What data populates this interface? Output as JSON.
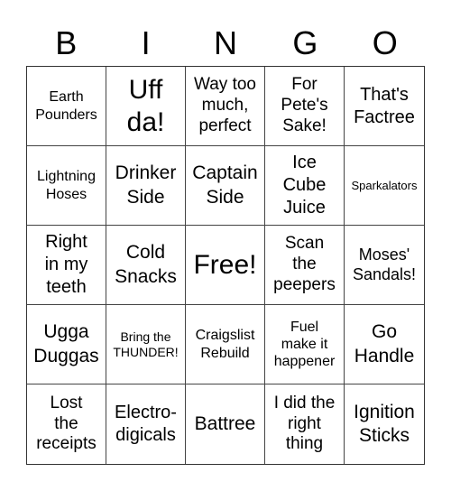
{
  "header": {
    "letters": [
      "B",
      "I",
      "N",
      "G",
      "O"
    ]
  },
  "board": {
    "cells": [
      "Earth\nPounders",
      "Uff\nda!",
      "Way too\nmuch,\nperfect",
      "For\nPete's\nSake!",
      "That's\nFactree",
      "Lightning\nHoses",
      "Drinker\nSide",
      "Captain\nSide",
      "Ice\nCube\nJuice",
      "Sparkalators",
      "Right\nin my\nteeth",
      "Cold\nSnacks",
      "Free!",
      "Scan\nthe\npeepers",
      "Moses'\nSandals!",
      "Ugga\nDuggas",
      "Bring the\nTHUNDER!",
      "Craigslist\nRebuild",
      "Fuel\nmake it\nhappener",
      "Go\nHandle",
      "Lost\nthe\nreceipts",
      "Electro-\ndigicals",
      "Battree",
      "I did the\nright\nthing",
      "Ignition\nSticks"
    ],
    "free_space": "Free!"
  }
}
